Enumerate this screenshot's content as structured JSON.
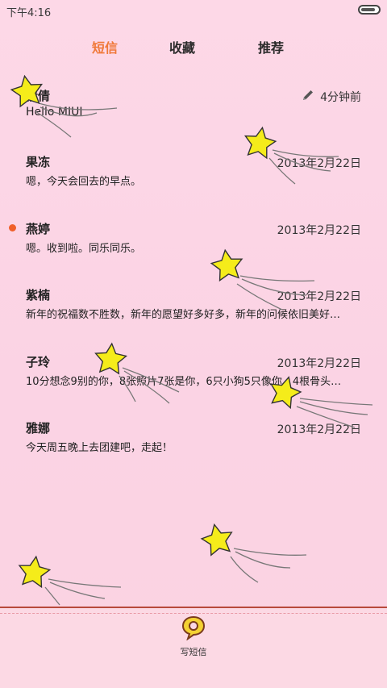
{
  "status_bar": {
    "time": "下午4:16",
    "battery_level": 0.85
  },
  "tabs": [
    {
      "label": "短信",
      "active": true
    },
    {
      "label": "收藏",
      "active": false
    },
    {
      "label": "推荐",
      "active": false
    }
  ],
  "conversations": [
    {
      "name": "倩倩",
      "time": "4分钟前",
      "preview": "Hello MIUI",
      "unread": false,
      "draft": true
    },
    {
      "name": "果冻",
      "time": "2013年2月22日",
      "preview": "嗯，今天会回去的早点。",
      "unread": false,
      "draft": false
    },
    {
      "name": "燕婷",
      "time": "2013年2月22日",
      "preview": "嗯。收到啦。同乐同乐。",
      "unread": true,
      "draft": false
    },
    {
      "name": "紫楠",
      "time": "2013年2月22日",
      "preview": "新年的祝福数不胜数，新年的愿望好多好多，新年的问候依旧美好…",
      "unread": false,
      "draft": false
    },
    {
      "name": "子玲",
      "time": "2013年2月22日",
      "preview": "10分想念9别的你，8张照片7张是你，6只小狗5只像你，4根骨头…",
      "unread": false,
      "draft": false
    },
    {
      "name": "雅娜",
      "time": "2013年2月22日",
      "preview": "今天周五晚上去团建吧，走起！",
      "unread": false,
      "draft": false
    }
  ],
  "compose": {
    "label": "写短信",
    "icon": "compose-message-icon"
  },
  "colors": {
    "accent": "#f07838",
    "unread_dot": "#f0602a",
    "background": "#fbd6e6",
    "star": "#f5ec1a"
  }
}
